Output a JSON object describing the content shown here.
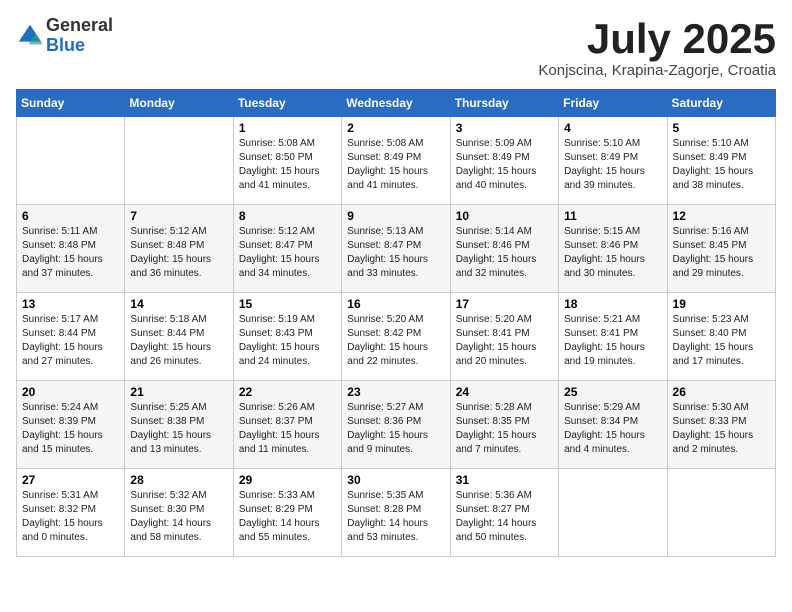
{
  "header": {
    "logo_line1": "General",
    "logo_line2": "Blue",
    "month": "July 2025",
    "location": "Konjscina, Krapina-Zagorje, Croatia"
  },
  "weekdays": [
    "Sunday",
    "Monday",
    "Tuesday",
    "Wednesday",
    "Thursday",
    "Friday",
    "Saturday"
  ],
  "weeks": [
    [
      {
        "day": "",
        "sunrise": "",
        "sunset": "",
        "daylight": ""
      },
      {
        "day": "",
        "sunrise": "",
        "sunset": "",
        "daylight": ""
      },
      {
        "day": "1",
        "sunrise": "Sunrise: 5:08 AM",
        "sunset": "Sunset: 8:50 PM",
        "daylight": "Daylight: 15 hours and 41 minutes."
      },
      {
        "day": "2",
        "sunrise": "Sunrise: 5:08 AM",
        "sunset": "Sunset: 8:49 PM",
        "daylight": "Daylight: 15 hours and 41 minutes."
      },
      {
        "day": "3",
        "sunrise": "Sunrise: 5:09 AM",
        "sunset": "Sunset: 8:49 PM",
        "daylight": "Daylight: 15 hours and 40 minutes."
      },
      {
        "day": "4",
        "sunrise": "Sunrise: 5:10 AM",
        "sunset": "Sunset: 8:49 PM",
        "daylight": "Daylight: 15 hours and 39 minutes."
      },
      {
        "day": "5",
        "sunrise": "Sunrise: 5:10 AM",
        "sunset": "Sunset: 8:49 PM",
        "daylight": "Daylight: 15 hours and 38 minutes."
      }
    ],
    [
      {
        "day": "6",
        "sunrise": "Sunrise: 5:11 AM",
        "sunset": "Sunset: 8:48 PM",
        "daylight": "Daylight: 15 hours and 37 minutes."
      },
      {
        "day": "7",
        "sunrise": "Sunrise: 5:12 AM",
        "sunset": "Sunset: 8:48 PM",
        "daylight": "Daylight: 15 hours and 36 minutes."
      },
      {
        "day": "8",
        "sunrise": "Sunrise: 5:12 AM",
        "sunset": "Sunset: 8:47 PM",
        "daylight": "Daylight: 15 hours and 34 minutes."
      },
      {
        "day": "9",
        "sunrise": "Sunrise: 5:13 AM",
        "sunset": "Sunset: 8:47 PM",
        "daylight": "Daylight: 15 hours and 33 minutes."
      },
      {
        "day": "10",
        "sunrise": "Sunrise: 5:14 AM",
        "sunset": "Sunset: 8:46 PM",
        "daylight": "Daylight: 15 hours and 32 minutes."
      },
      {
        "day": "11",
        "sunrise": "Sunrise: 5:15 AM",
        "sunset": "Sunset: 8:46 PM",
        "daylight": "Daylight: 15 hours and 30 minutes."
      },
      {
        "day": "12",
        "sunrise": "Sunrise: 5:16 AM",
        "sunset": "Sunset: 8:45 PM",
        "daylight": "Daylight: 15 hours and 29 minutes."
      }
    ],
    [
      {
        "day": "13",
        "sunrise": "Sunrise: 5:17 AM",
        "sunset": "Sunset: 8:44 PM",
        "daylight": "Daylight: 15 hours and 27 minutes."
      },
      {
        "day": "14",
        "sunrise": "Sunrise: 5:18 AM",
        "sunset": "Sunset: 8:44 PM",
        "daylight": "Daylight: 15 hours and 26 minutes."
      },
      {
        "day": "15",
        "sunrise": "Sunrise: 5:19 AM",
        "sunset": "Sunset: 8:43 PM",
        "daylight": "Daylight: 15 hours and 24 minutes."
      },
      {
        "day": "16",
        "sunrise": "Sunrise: 5:20 AM",
        "sunset": "Sunset: 8:42 PM",
        "daylight": "Daylight: 15 hours and 22 minutes."
      },
      {
        "day": "17",
        "sunrise": "Sunrise: 5:20 AM",
        "sunset": "Sunset: 8:41 PM",
        "daylight": "Daylight: 15 hours and 20 minutes."
      },
      {
        "day": "18",
        "sunrise": "Sunrise: 5:21 AM",
        "sunset": "Sunset: 8:41 PM",
        "daylight": "Daylight: 15 hours and 19 minutes."
      },
      {
        "day": "19",
        "sunrise": "Sunrise: 5:23 AM",
        "sunset": "Sunset: 8:40 PM",
        "daylight": "Daylight: 15 hours and 17 minutes."
      }
    ],
    [
      {
        "day": "20",
        "sunrise": "Sunrise: 5:24 AM",
        "sunset": "Sunset: 8:39 PM",
        "daylight": "Daylight: 15 hours and 15 minutes."
      },
      {
        "day": "21",
        "sunrise": "Sunrise: 5:25 AM",
        "sunset": "Sunset: 8:38 PM",
        "daylight": "Daylight: 15 hours and 13 minutes."
      },
      {
        "day": "22",
        "sunrise": "Sunrise: 5:26 AM",
        "sunset": "Sunset: 8:37 PM",
        "daylight": "Daylight: 15 hours and 11 minutes."
      },
      {
        "day": "23",
        "sunrise": "Sunrise: 5:27 AM",
        "sunset": "Sunset: 8:36 PM",
        "daylight": "Daylight: 15 hours and 9 minutes."
      },
      {
        "day": "24",
        "sunrise": "Sunrise: 5:28 AM",
        "sunset": "Sunset: 8:35 PM",
        "daylight": "Daylight: 15 hours and 7 minutes."
      },
      {
        "day": "25",
        "sunrise": "Sunrise: 5:29 AM",
        "sunset": "Sunset: 8:34 PM",
        "daylight": "Daylight: 15 hours and 4 minutes."
      },
      {
        "day": "26",
        "sunrise": "Sunrise: 5:30 AM",
        "sunset": "Sunset: 8:33 PM",
        "daylight": "Daylight: 15 hours and 2 minutes."
      }
    ],
    [
      {
        "day": "27",
        "sunrise": "Sunrise: 5:31 AM",
        "sunset": "Sunset: 8:32 PM",
        "daylight": "Daylight: 15 hours and 0 minutes."
      },
      {
        "day": "28",
        "sunrise": "Sunrise: 5:32 AM",
        "sunset": "Sunset: 8:30 PM",
        "daylight": "Daylight: 14 hours and 58 minutes."
      },
      {
        "day": "29",
        "sunrise": "Sunrise: 5:33 AM",
        "sunset": "Sunset: 8:29 PM",
        "daylight": "Daylight: 14 hours and 55 minutes."
      },
      {
        "day": "30",
        "sunrise": "Sunrise: 5:35 AM",
        "sunset": "Sunset: 8:28 PM",
        "daylight": "Daylight: 14 hours and 53 minutes."
      },
      {
        "day": "31",
        "sunrise": "Sunrise: 5:36 AM",
        "sunset": "Sunset: 8:27 PM",
        "daylight": "Daylight: 14 hours and 50 minutes."
      },
      {
        "day": "",
        "sunrise": "",
        "sunset": "",
        "daylight": ""
      },
      {
        "day": "",
        "sunrise": "",
        "sunset": "",
        "daylight": ""
      }
    ]
  ]
}
